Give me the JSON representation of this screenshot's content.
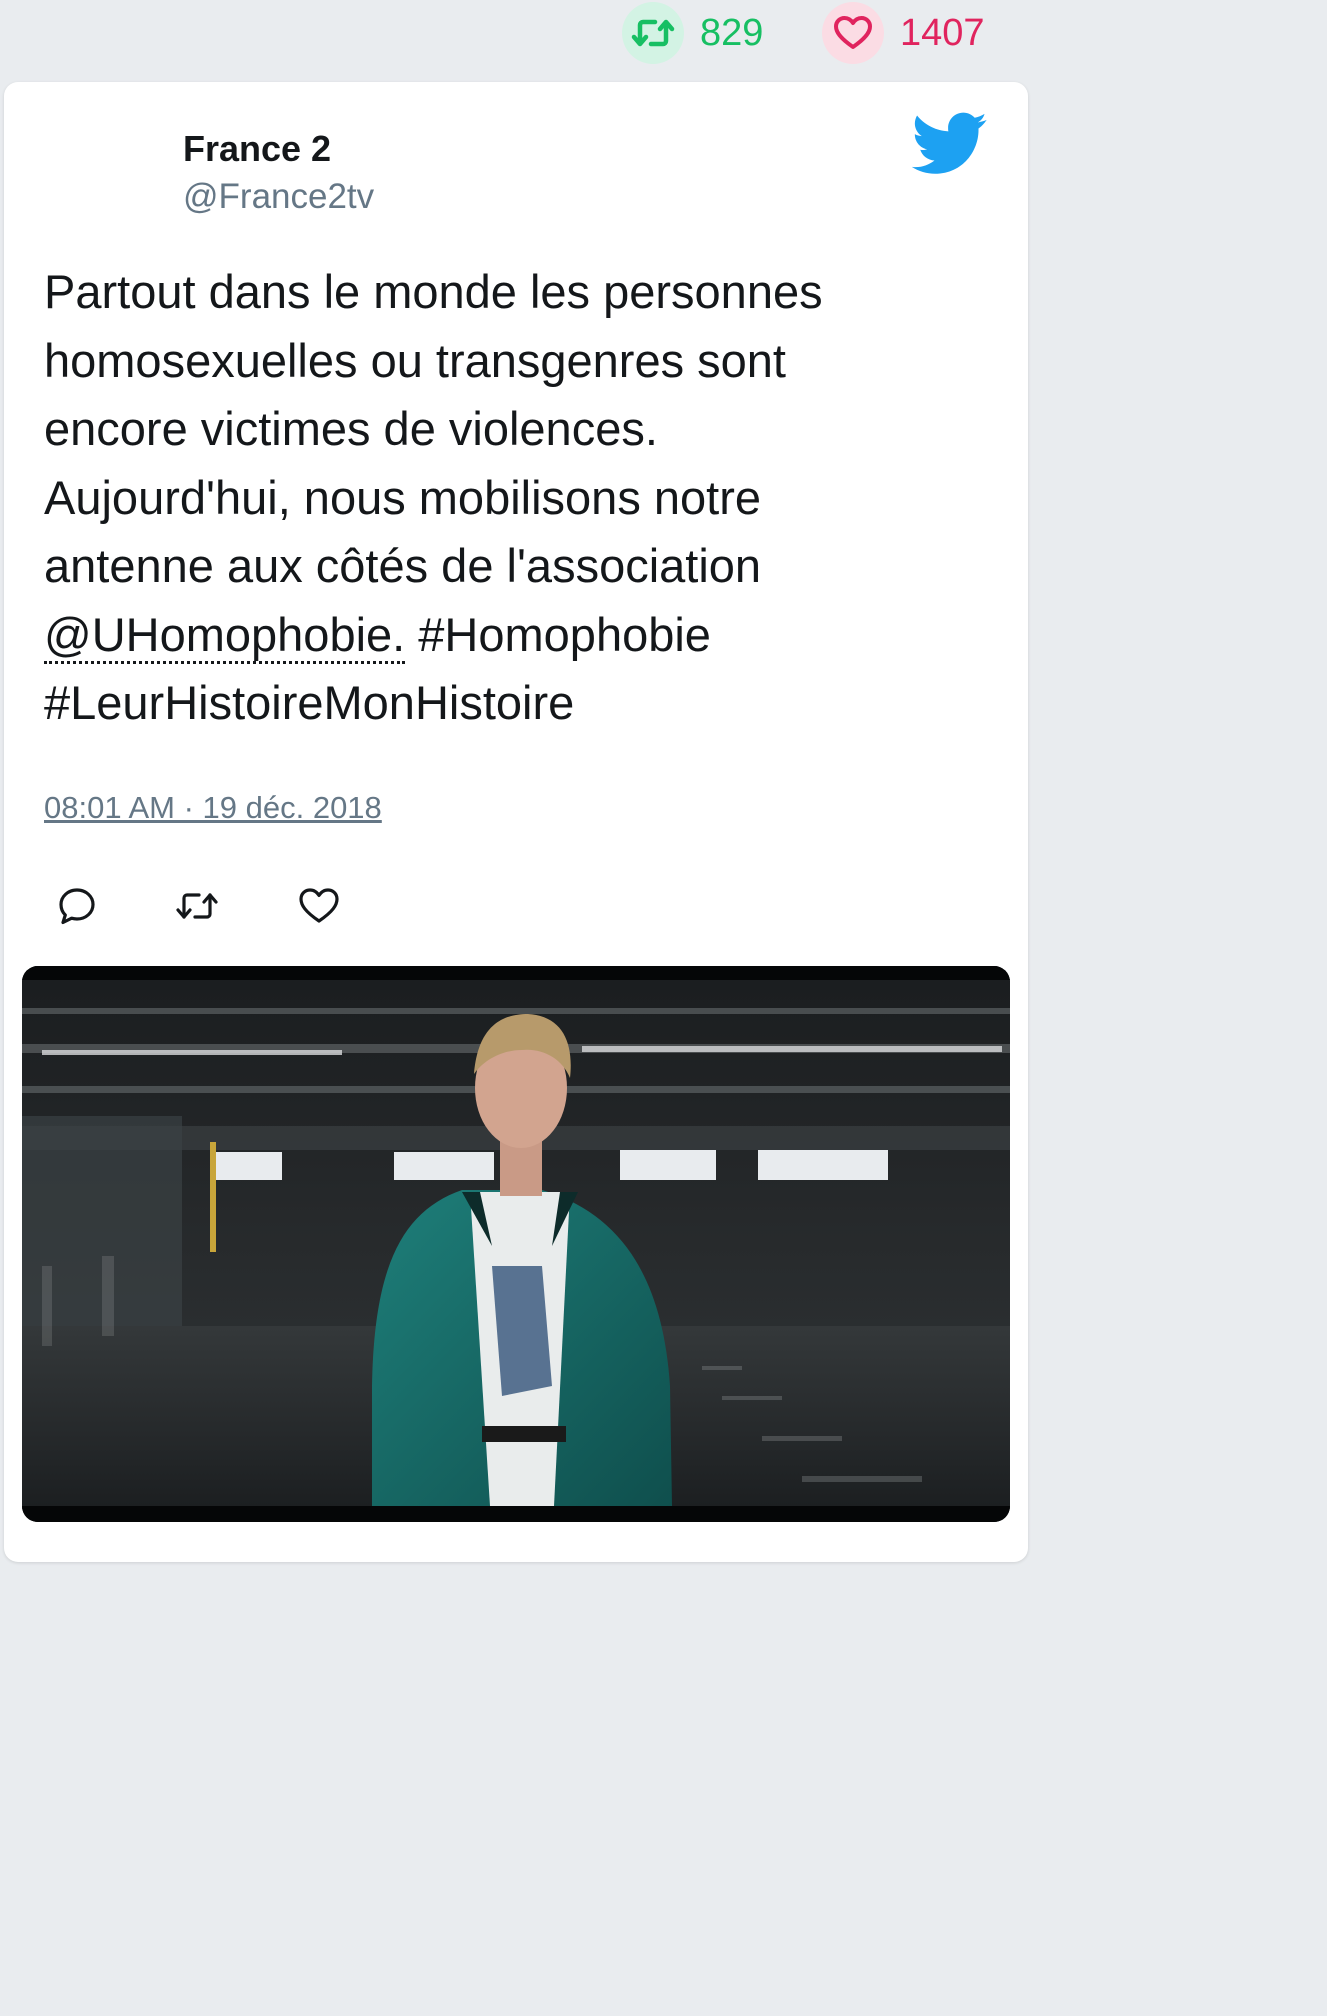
{
  "stats": {
    "retweet_count": "829",
    "like_count": "1407"
  },
  "author": {
    "name": "France 2",
    "handle": "@France2tv"
  },
  "tweet": {
    "text_lines": [
      "Partout dans le monde les personnes",
      "homosexuelles ou transgenres sont",
      "encore victimes de violences.",
      "Aujourd'hui, nous mobilisons notre",
      "antenne aux côtés de l'association"
    ],
    "mention": "@UHomophobie.",
    "hashtag_1": "#Homophobie",
    "hashtag_2": "#LeurHistoireMonHistoire",
    "timestamp": "08:01 AM · 19 déc. 2018"
  },
  "icons": {
    "top_retweet": "retweet-icon",
    "top_like": "heart-icon",
    "brand": "twitter-bird-icon",
    "reply": "reply-icon",
    "retweet": "retweet-icon",
    "like": "heart-icon"
  },
  "colors": {
    "retweet_green": "#17bf63",
    "like_red": "#e0245e",
    "twitter_blue": "#1da1f2",
    "secondary_text": "#657786"
  }
}
